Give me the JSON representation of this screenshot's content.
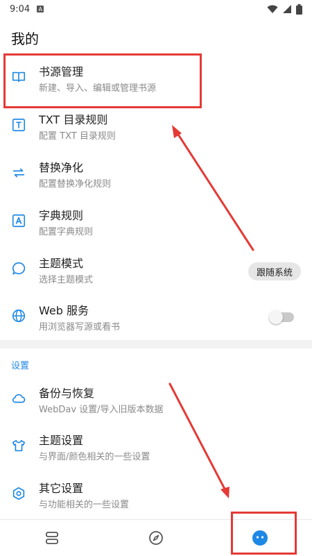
{
  "status_bar": {
    "time": "9:04",
    "notif_glyph": "A"
  },
  "page": {
    "title": "我的"
  },
  "menu": [
    {
      "title": "书源管理",
      "subtitle": "新建、导入、编辑或管理书源",
      "icon": "book-open-icon"
    },
    {
      "title": "TXT 目录规则",
      "subtitle": "配置 TXT 目录规则",
      "icon": "txt-box-icon"
    },
    {
      "title": "替换净化",
      "subtitle": "配置替换净化规则",
      "icon": "swap-arrows-icon"
    },
    {
      "title": "字典规则",
      "subtitle": "配置字典规则",
      "icon": "dictionary-box-icon"
    },
    {
      "title": "主题模式",
      "subtitle": "选择主题模式",
      "icon": "speech-bubble-icon",
      "chip": "跟随系统"
    },
    {
      "title": "Web 服务",
      "subtitle": "用浏览器写源或看书",
      "icon": "globe-icon",
      "toggle_on": false
    }
  ],
  "settings": {
    "label": "设置",
    "items": [
      {
        "title": "备份与恢复",
        "subtitle": "WebDav 设置/导入旧版本数据",
        "icon": "cloud-icon"
      },
      {
        "title": "主题设置",
        "subtitle": "与界面/颜色相关的一些设置",
        "icon": "tshirt-icon"
      },
      {
        "title": "其它设置",
        "subtitle": "与功能相关的一些设置",
        "icon": "hexagon-settings-icon"
      }
    ]
  },
  "bottom_nav": {
    "items": [
      {
        "icon": "bookshelf-icon",
        "active": false
      },
      {
        "icon": "compass-icon",
        "active": false
      },
      {
        "icon": "my-face-icon",
        "active": true
      }
    ]
  },
  "colors": {
    "accent": "#1e88e5",
    "icon_blue": "#1e88e5",
    "annotation_red": "#e53935"
  }
}
